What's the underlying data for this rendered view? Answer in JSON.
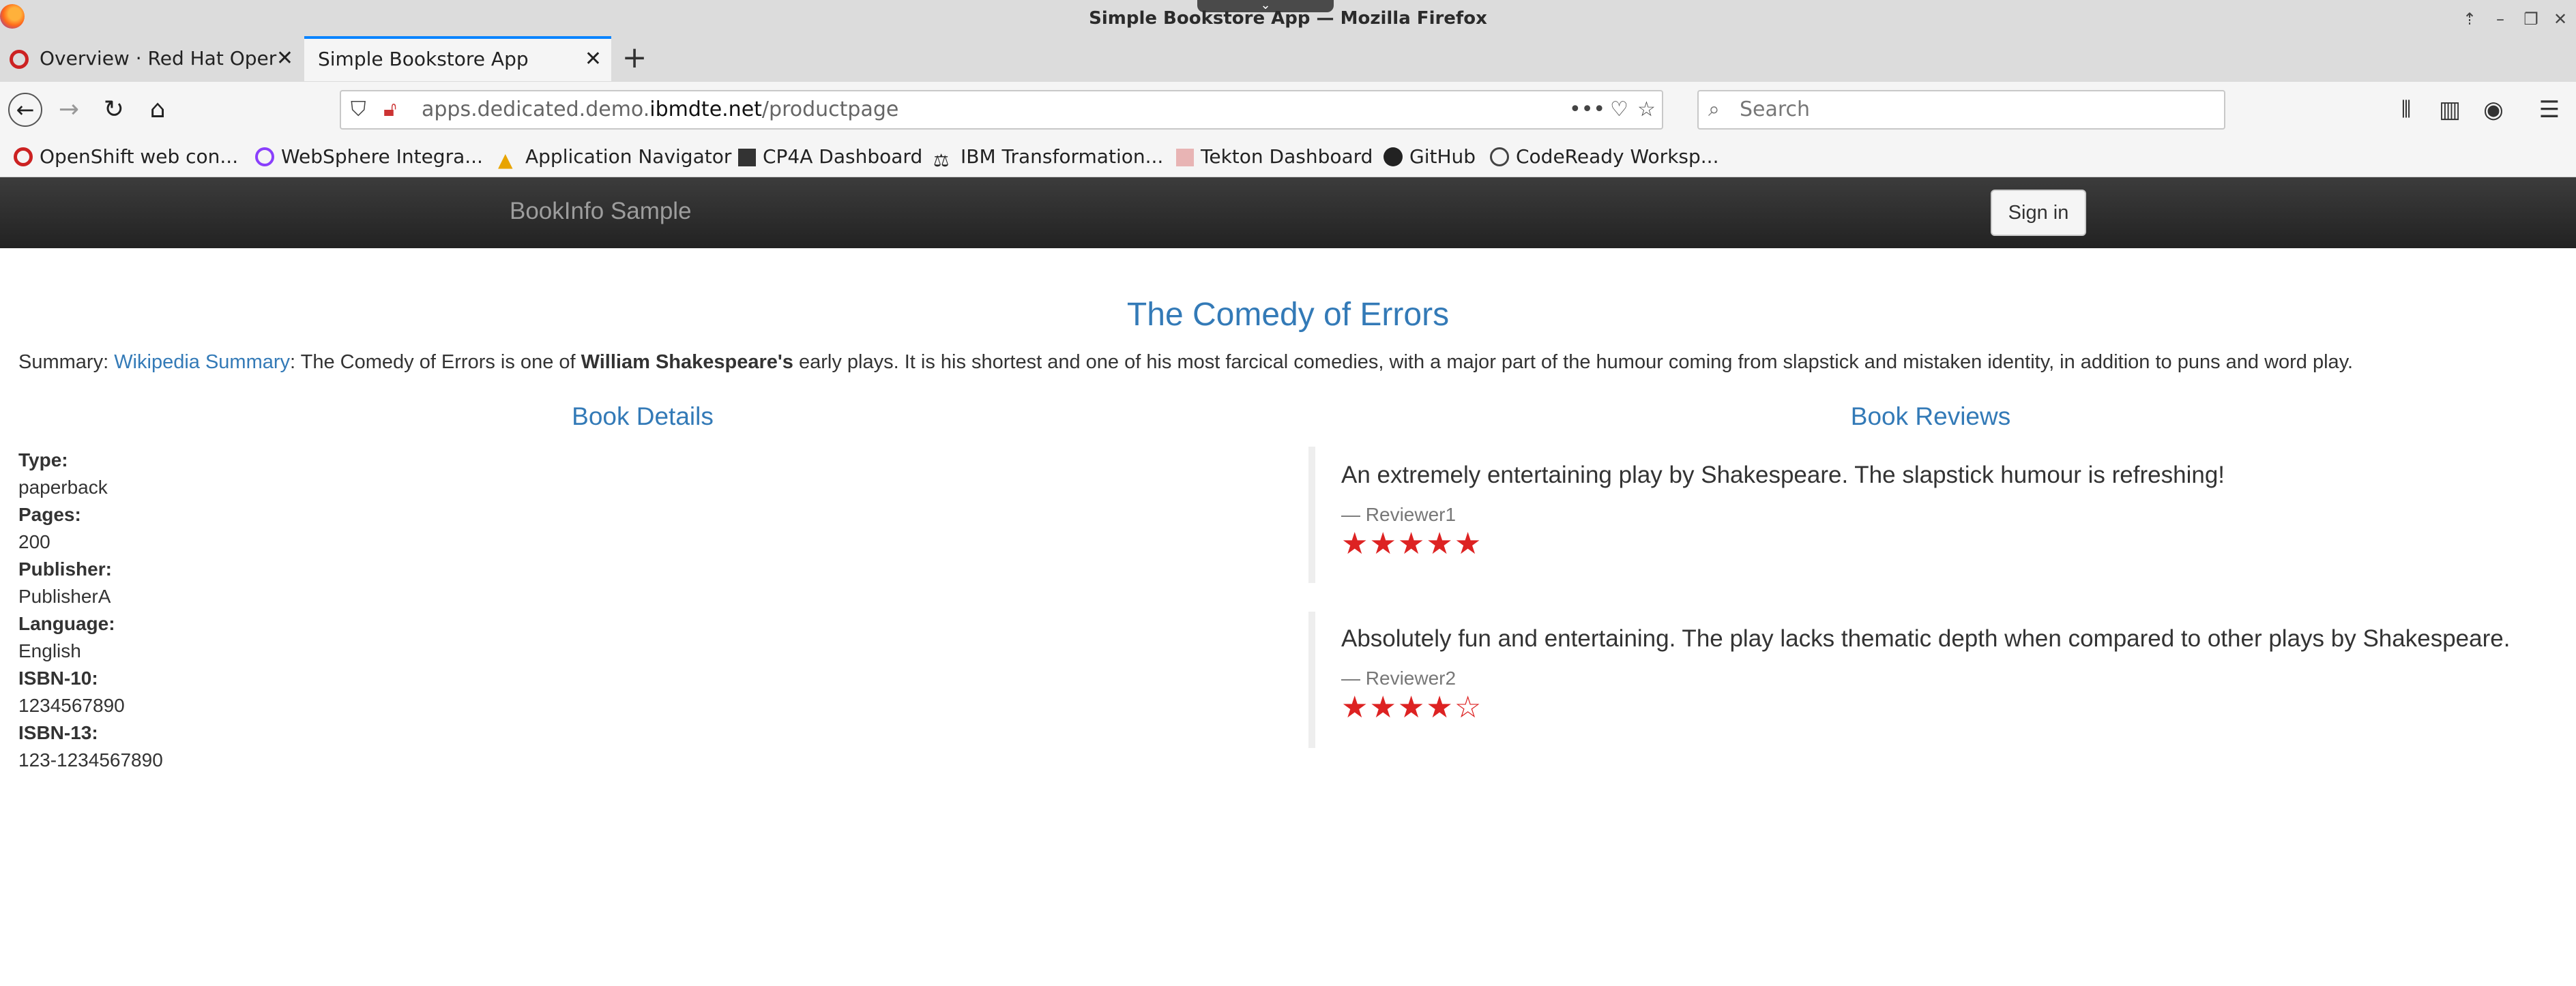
{
  "window": {
    "title": "Simple Bookstore App — Mozilla Firefox"
  },
  "tabs": [
    {
      "label": "Overview · Red Hat Oper",
      "active": false
    },
    {
      "label": "Simple Bookstore App",
      "active": true
    }
  ],
  "navbar": {
    "url_prefix": "apps.dedicated.demo.",
    "url_host": "ibmdte.net",
    "url_path": "/productpage",
    "search_placeholder": "Search"
  },
  "bookmarks": [
    {
      "label": "OpenShift web con...",
      "icon": "openshift-icon"
    },
    {
      "label": "WebSphere Integra...",
      "icon": "websphere-icon"
    },
    {
      "label": "Application Navigator",
      "icon": "navigator-icon"
    },
    {
      "label": "CP4A Dashboard",
      "icon": "cp4a-icon"
    },
    {
      "label": "IBM Transformation...",
      "icon": "ibm-icon"
    },
    {
      "label": "Tekton Dashboard",
      "icon": "tekton-icon"
    },
    {
      "label": "GitHub",
      "icon": "github-icon"
    },
    {
      "label": "CodeReady Worksp...",
      "icon": "globe-icon"
    }
  ],
  "app": {
    "brand": "BookInfo Sample",
    "signin_label": "Sign in"
  },
  "book": {
    "title": "The Comedy of Errors",
    "summary_prefix": "Summary: ",
    "summary_link": "Wikipedia Summary",
    "summary_mid": ": The Comedy of Errors is one of ",
    "summary_bold": "William Shakespeare's",
    "summary_rest": " early plays. It is his shortest and one of his most farcical comedies, with a major part of the humour coming from slapstick and mistaken identity, in addition to puns and word play."
  },
  "details": {
    "heading": "Book Details",
    "fields": [
      {
        "label": "Type:",
        "value": "paperback"
      },
      {
        "label": "Pages:",
        "value": "200"
      },
      {
        "label": "Publisher:",
        "value": "PublisherA"
      },
      {
        "label": "Language:",
        "value": "English"
      },
      {
        "label": "ISBN-10:",
        "value": "1234567890"
      },
      {
        "label": "ISBN-13:",
        "value": "123-1234567890"
      }
    ]
  },
  "reviews": {
    "heading": "Book Reviews",
    "items": [
      {
        "text": "An extremely entertaining play by Shakespeare. The slapstick humour is refreshing!",
        "author": "— Reviewer1",
        "stars": 5,
        "star_color": "#dd2222"
      },
      {
        "text": "Absolutely fun and entertaining. The play lacks thematic depth when compared to other plays by Shakespeare.",
        "author": "— Reviewer2",
        "stars": 4,
        "star_color": "#dd2222"
      }
    ]
  },
  "colors": {
    "link": "#337ab7",
    "header_bg": "#222222",
    "accent_tab": "#0a84ff"
  }
}
